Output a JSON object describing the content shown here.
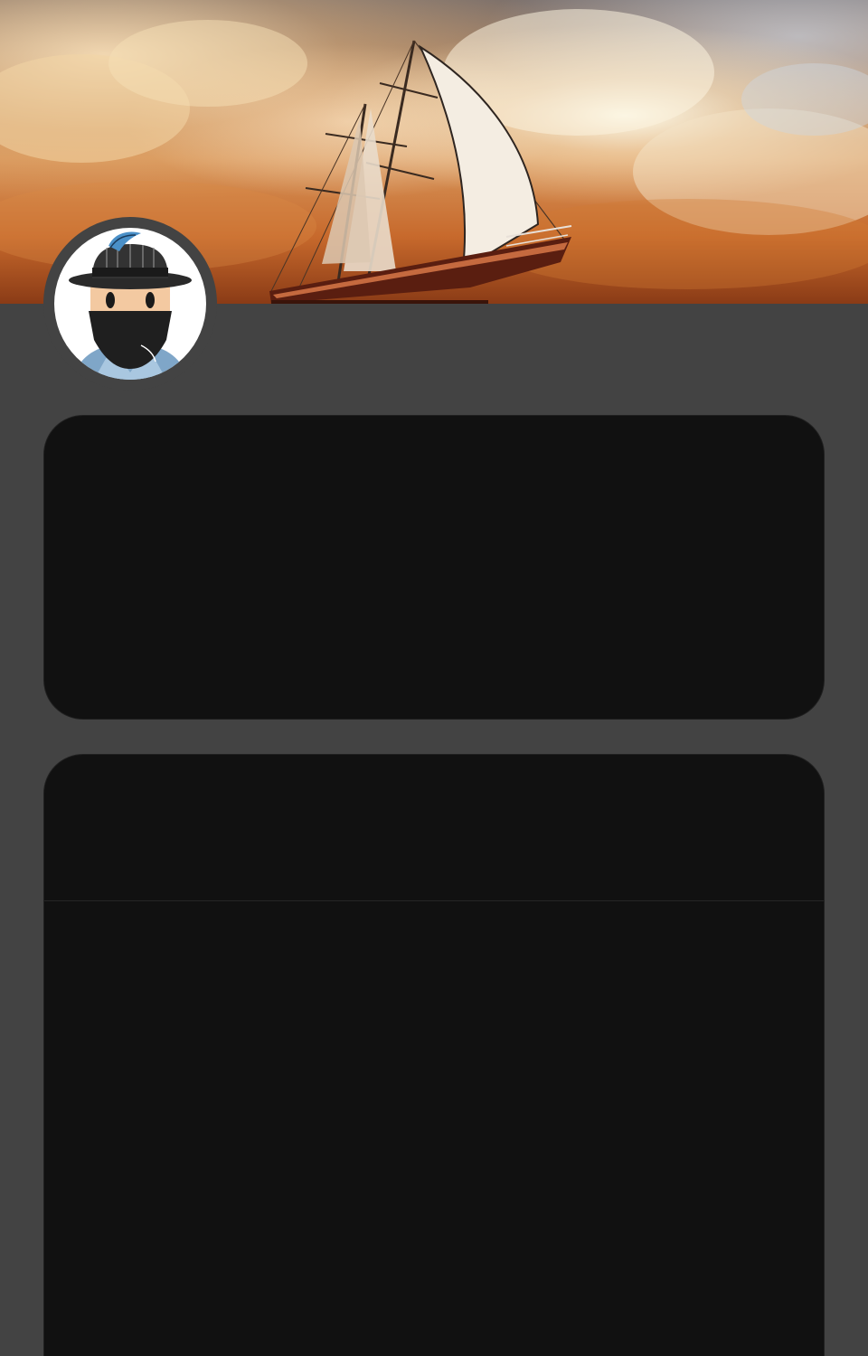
{
  "profile": {
    "banner_icon": "sailboat-sunset-image",
    "avatar_icon": "masked-character-avatar"
  },
  "colors": {
    "page_background": "#434343",
    "card_background": "#111111",
    "avatar_ring": "#434343"
  }
}
